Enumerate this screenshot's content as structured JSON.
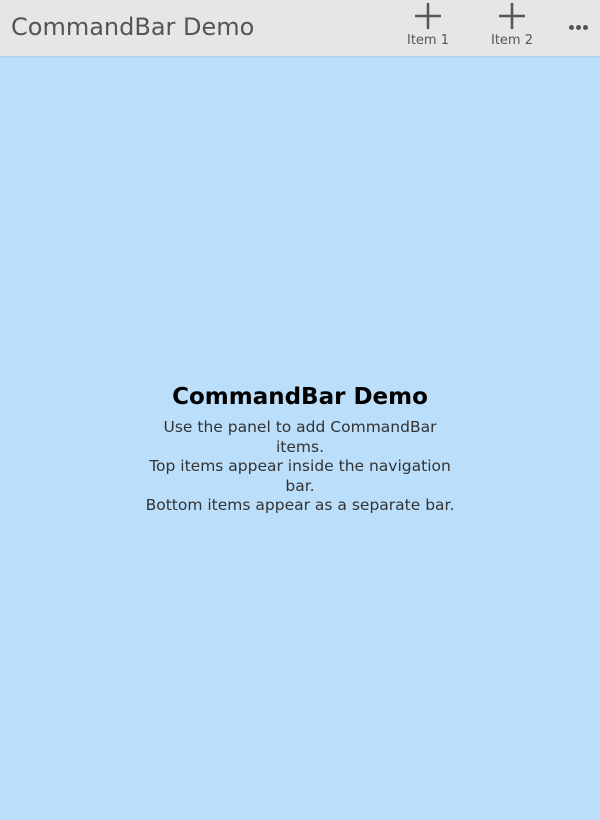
{
  "navbar": {
    "title": "CommandBar Demo",
    "items": [
      {
        "label": "Item 1",
        "icon": "plus-icon"
      },
      {
        "label": "Item 2",
        "icon": "plus-icon"
      }
    ],
    "overflow_icon": "more-horizontal-icon"
  },
  "content": {
    "title": "CommandBar Demo",
    "lines": [
      "Use the panel to add CommandBar items.",
      "Top items appear inside the navigation bar.",
      "Bottom items appear as a separate bar."
    ]
  },
  "colors": {
    "background": "#bbdefa",
    "navbar": "#e6e6e6",
    "nav_text": "#555555",
    "title_text": "#000000",
    "body_text": "#333333"
  }
}
